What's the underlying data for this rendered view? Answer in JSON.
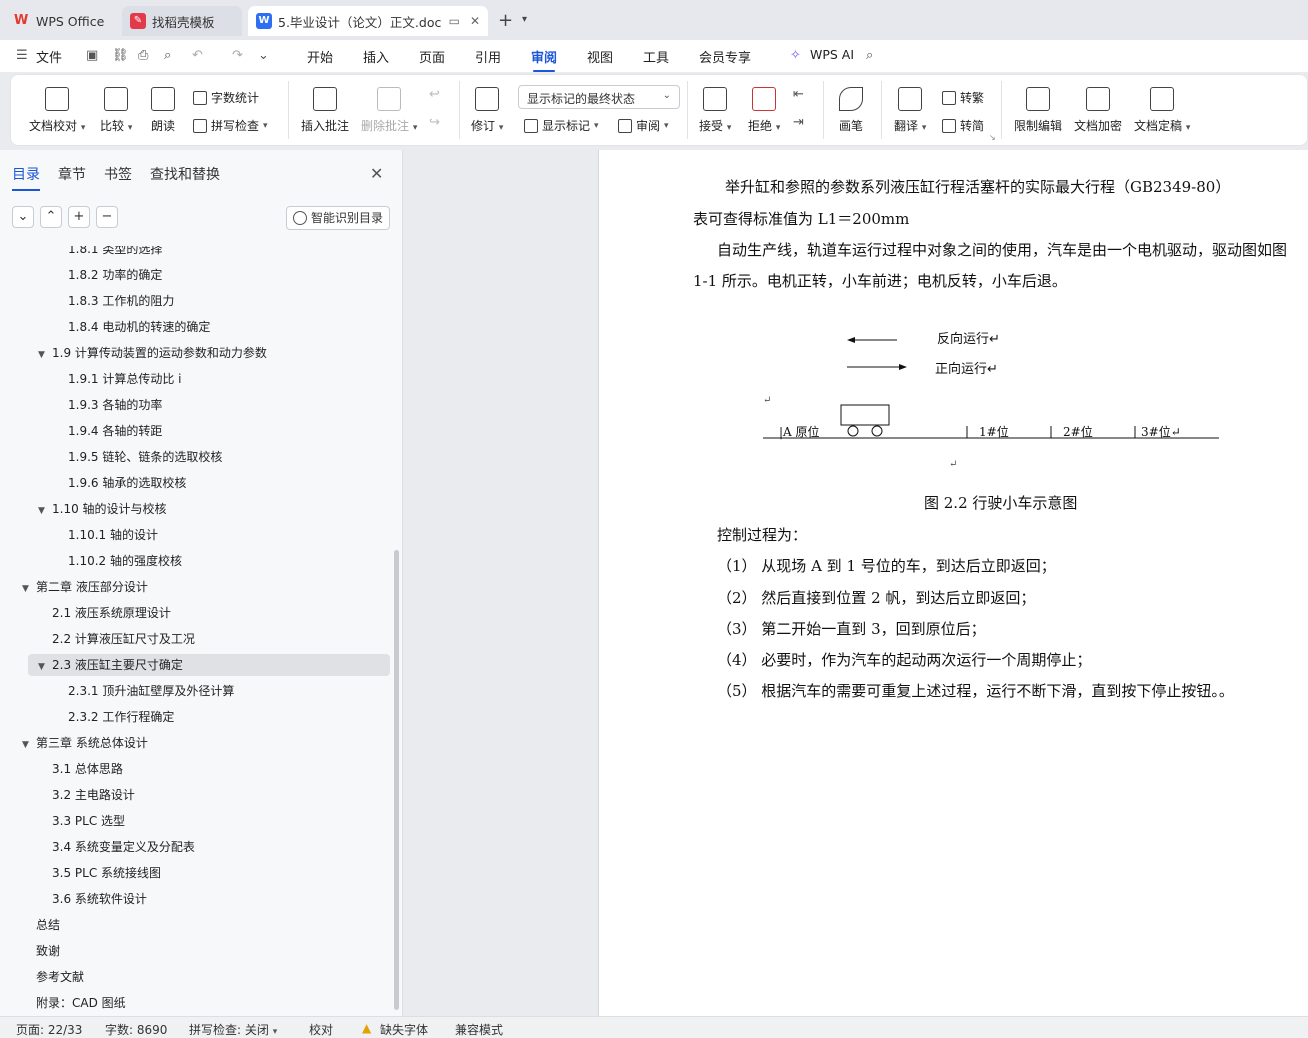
{
  "tabs": [
    {
      "label": "WPS Office"
    },
    {
      "label": "找稻壳模板"
    },
    {
      "label": "5.毕业设计（论文）正文.doc"
    }
  ],
  "menubar": {
    "file": "文件",
    "items": [
      "开始",
      "插入",
      "页面",
      "引用",
      "审阅",
      "视图",
      "工具",
      "会员专享"
    ],
    "active": "审阅",
    "wps_ai": "WPS AI"
  },
  "ribbon": {
    "doc_proof": "文档校对",
    "compare": "比较",
    "read_aloud": "朗读",
    "word_count": "字数统计",
    "spell_check": "拼写检查",
    "insert_comment": "插入批注",
    "delete_comment": "删除批注",
    "track": "修订",
    "markup_state": "显示标记的最终状态",
    "show_markup": "显示标记",
    "review": "审阅",
    "accept": "接受",
    "reject": "拒绝",
    "pen": "画笔",
    "translate": "翻译",
    "to_traditional": "转繁",
    "to_simplified": "转简",
    "restrict_edit": "限制编辑",
    "encrypt": "文档加密",
    "finalize": "文档定稿"
  },
  "nav": {
    "tabs": [
      "目录",
      "章节",
      "书签",
      "查找和替换"
    ],
    "smart_btn": "智能识别目录",
    "toc": [
      {
        "label": "1.8.1 类型的选择",
        "level": 3
      },
      {
        "label": "1.8.2 功率的确定",
        "level": 3
      },
      {
        "label": "1.8.3 工作机的阻力",
        "level": 3
      },
      {
        "label": "1.8.4 电动机的转速的确定",
        "level": 3
      },
      {
        "label": "1.9 计算传动装置的运动参数和动力参数",
        "level": 2,
        "expanded": true
      },
      {
        "label": "1.9.1  计算总传动比 i",
        "level": 3
      },
      {
        "label": "1.9.3  各轴的功率",
        "level": 3
      },
      {
        "label": "1.9.4 各轴的转距",
        "level": 3
      },
      {
        "label": "1.9.5 链轮、链条的选取校核",
        "level": 3
      },
      {
        "label": "1.9.6  轴承的选取校核",
        "level": 3
      },
      {
        "label": "1.10 轴的设计与校核",
        "level": 2,
        "expanded": true
      },
      {
        "label": "1.10.1 轴的设计",
        "level": 3
      },
      {
        "label": "1.10.2  轴的强度校核",
        "level": 3
      },
      {
        "label": "第二章  液压部分设计",
        "level": 1,
        "expanded": true
      },
      {
        "label": "2.1 液压系统原理设计",
        "level": 2
      },
      {
        "label": "2.2 计算液压缸尺寸及工况",
        "level": 2
      },
      {
        "label": "2.3 液压缸主要尺寸确定",
        "level": 2,
        "expanded": true,
        "selected": true
      },
      {
        "label": "2.3.1 顶升油缸壁厚及外径计算",
        "level": 3
      },
      {
        "label": "2.3.2 工作行程确定",
        "level": 3
      },
      {
        "label": "第三章  系统总体设计",
        "level": 1,
        "expanded": true
      },
      {
        "label": "3.1 总体思路",
        "level": 2
      },
      {
        "label": "3.2 主电路设计",
        "level": 2
      },
      {
        "label": "3.3 PLC 选型",
        "level": 2
      },
      {
        "label": "3.4 系统变量定义及分配表",
        "level": 2
      },
      {
        "label": "3.5 PLC 系统接线图",
        "level": 2
      },
      {
        "label": "3.6 系统软件设计",
        "level": 2
      },
      {
        "label": "总结",
        "level": 1
      },
      {
        "label": "致谢",
        "level": 1
      },
      {
        "label": "参考文献",
        "level": 1
      },
      {
        "label": "附录：CAD 图纸",
        "level": 1
      }
    ]
  },
  "document": {
    "lines": [
      "举升缸和参照的参数系列液压缸行程活塞杆的实际最大行程（GB2349-80）",
      "表可查得标准值为 L1＝200mm",
      "自动生产线，轨道车运行过程中对象之间的使用，汽车是由一个电机驱动，驱动图如图",
      "1-1 所示。电机正转，小车前进；电机反转，小车后退。"
    ],
    "diagram": {
      "reverse": "反向运行↵",
      "forward": "正向运行↵",
      "origin": "|A 原位",
      "pos1": "1#位",
      "pos2": "2#位",
      "pos3": "3#位↵",
      "return_mark": "↵"
    },
    "caption": "图 2.2  行驶小车示意图",
    "control_title": "控制过程为：",
    "steps": [
      "（1）  从现场 A 到 1 号位的车，到达后立即返回；",
      "（2）  然后直接到位置 2 帆，到达后立即返回；",
      "（3）  第二开始一直到 3，回到原位后；",
      "（4）  必要时，作为汽车的起动两次运行一个周期停止；",
      "（5）  根据汽车的需要可重复上述过程，运行不断下滑，直到按下停止按钮。。"
    ]
  },
  "status": {
    "page": "页面: 22/33",
    "words": "字数: 8690",
    "spell": "拼写检查: 关闭",
    "proof": "校对",
    "missing_font": "缺失字体",
    "compat": "兼容模式"
  }
}
